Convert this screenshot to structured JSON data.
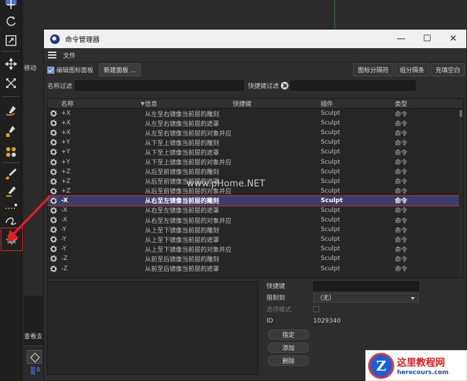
{
  "app": {
    "viewport_label": "移动",
    "view_menu_label": "查看支",
    "frame_number": "0"
  },
  "toolbar": {
    "tools": [
      "move-arrows-icon",
      "rotate-icon",
      "scale-icon",
      "move-icon",
      "scale-arrows-icon",
      "brush-stroke-icon",
      "brush-fill-icon",
      "brush-multi-icon",
      "paint-brush-icon",
      "knife-icon",
      "dashed-line-icon",
      "curve-icon",
      "gear-icon"
    ]
  },
  "dialog": {
    "title": "命令管理器",
    "window_buttons": {
      "minimize": "—",
      "maximize": "☐",
      "close": "✕"
    },
    "menu_file": "文件",
    "edit_icon_panel": "编辑图标面板",
    "new_panel": "新建面板 ...",
    "icon_separator": "图标分隔符",
    "group_separator": "组分隔条",
    "fill_space": "充填空白",
    "name_filter_label": "名称过滤",
    "hotkey_filter_label": "快捷键过滤"
  },
  "table": {
    "headers": {
      "name": "名称",
      "info": "信息",
      "hotkey": "快捷键",
      "plugin": "插件",
      "type": "类型"
    },
    "sort_indicator": "▼",
    "rows": [
      {
        "name": "+X",
        "info": "从左至右镜像当前层的雕刻",
        "hotkey": "",
        "plugin": "Sculpt",
        "type": "命令"
      },
      {
        "name": "+X",
        "info": "从左至右镜像当前层的遮罩",
        "hotkey": "",
        "plugin": "Sculpt",
        "type": "命令"
      },
      {
        "name": "+X",
        "info": "从左至右镜像当前层的对象并应",
        "hotkey": "",
        "plugin": "Sculpt",
        "type": "命令"
      },
      {
        "name": "+Y",
        "info": "从下至上镜像当前层的雕刻",
        "hotkey": "",
        "plugin": "Sculpt",
        "type": "命令"
      },
      {
        "name": "+Y",
        "info": "从下至上镜像当前层的遮罩",
        "hotkey": "",
        "plugin": "Sculpt",
        "type": "命令"
      },
      {
        "name": "+Y",
        "info": "从下至上镜像当前层的对象并应",
        "hotkey": "",
        "plugin": "Sculpt",
        "type": "命令"
      },
      {
        "name": "+Z",
        "info": "从后至前镜像当前层的雕刻",
        "hotkey": "",
        "plugin": "Sculpt",
        "type": "命令"
      },
      {
        "name": "+Z",
        "info": "从后至前镜像当前层的遮罩",
        "hotkey": "",
        "plugin": "Sculpt",
        "type": "命令"
      },
      {
        "name": "+Z",
        "info": "从后至前镜像当前层的对象并应",
        "hotkey": "",
        "plugin": "Sculpt",
        "type": "命令"
      },
      {
        "name": "-X",
        "info": "从右至左镜像当前层的雕刻",
        "hotkey": "",
        "plugin": "Sculpt",
        "type": "命令",
        "selected": true
      },
      {
        "name": "-X",
        "info": "从右至左镜像当前层的遮罩",
        "hotkey": "",
        "plugin": "Sculpt",
        "type": "命令"
      },
      {
        "name": "-X",
        "info": "从右至左镜像当前层的对象并应",
        "hotkey": "",
        "plugin": "Sculpt",
        "type": "命令"
      },
      {
        "name": "-Y",
        "info": "从上至下镜像当前层的雕刻",
        "hotkey": "",
        "plugin": "Sculpt",
        "type": "命令"
      },
      {
        "name": "-Y",
        "info": "从上至下镜像当前层的遮罩",
        "hotkey": "",
        "plugin": "Sculpt",
        "type": "命令"
      },
      {
        "name": "-Y",
        "info": "从上至下镜像当前层的对象并应",
        "hotkey": "",
        "plugin": "Sculpt",
        "type": "命令"
      },
      {
        "name": "-Z",
        "info": "从前至后镜像当前层的雕刻",
        "hotkey": "",
        "plugin": "Sculpt",
        "type": "命令"
      },
      {
        "name": "-Z",
        "info": "从前至后镜像当前层的遮罩",
        "hotkey": "",
        "plugin": "Sculpt",
        "type": "命令"
      }
    ]
  },
  "properties": {
    "hotkey_label": "快捷键",
    "restrict_label": "限制到",
    "restrict_value": "（无）",
    "option_mode_label": "选项模式",
    "id_label": "ID",
    "id_value": "1029340",
    "assign_button": "指定",
    "add_button": "添加",
    "delete_button": "删除"
  },
  "overlay": {
    "watermark": "www.pHome.NET",
    "logo_letter": "Z",
    "logo_cn": "这里教程网",
    "logo_url": "herecours.com"
  },
  "colors": {
    "selection": "#3a3f6a",
    "highlight_red": "#d42828",
    "checkbox_blue": "#6a8fd6"
  }
}
